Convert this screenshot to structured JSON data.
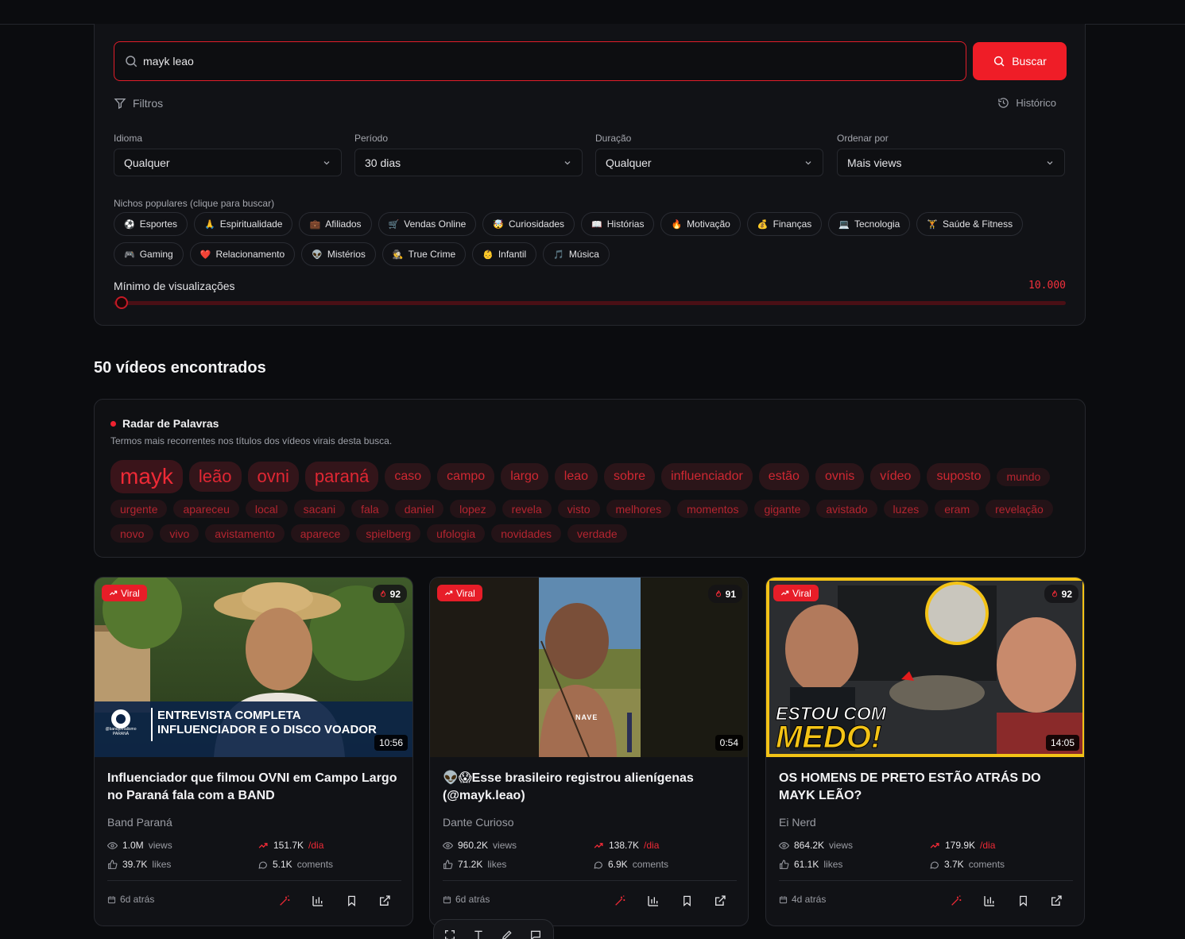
{
  "search": {
    "value": "mayk leao",
    "button_label": "Buscar"
  },
  "filters": {
    "toggle_label": "Filtros",
    "history_label": "Histórico",
    "idioma": {
      "label": "Idioma",
      "value": "Qualquer"
    },
    "periodo": {
      "label": "Período",
      "value": "30 dias"
    },
    "duracao": {
      "label": "Duração",
      "value": "Qualquer"
    },
    "ordenar": {
      "label": "Ordenar por",
      "value": "Mais views"
    }
  },
  "nichos": {
    "label": "Nichos populares (clique para buscar)",
    "items": [
      {
        "emoji": "⚽",
        "label": "Esportes"
      },
      {
        "emoji": "🙏",
        "label": "Espiritualidade"
      },
      {
        "emoji": "💼",
        "label": "Afiliados"
      },
      {
        "emoji": "🛒",
        "label": "Vendas Online"
      },
      {
        "emoji": "🤯",
        "label": "Curiosidades"
      },
      {
        "emoji": "📖",
        "label": "Histórias"
      },
      {
        "emoji": "🔥",
        "label": "Motivação"
      },
      {
        "emoji": "💰",
        "label": "Finanças"
      },
      {
        "emoji": "💻",
        "label": "Tecnologia"
      },
      {
        "emoji": "🏋",
        "label": "Saúde & Fitness"
      },
      {
        "emoji": "🎮",
        "label": "Gaming"
      },
      {
        "emoji": "❤️",
        "label": "Relacionamento"
      },
      {
        "emoji": "👽",
        "label": "Mistérios"
      },
      {
        "emoji": "🕵",
        "label": "True Crime"
      },
      {
        "emoji": "👶",
        "label": "Infantil"
      },
      {
        "emoji": "🎵",
        "label": "Música"
      }
    ]
  },
  "min_views": {
    "label": "Mínimo de visualizações",
    "value": "10.000",
    "fraction": 0.0
  },
  "results_title": "50 vídeos encontrados",
  "radar": {
    "title": "Radar de Palavras",
    "subtitle": "Termos mais recorrentes nos títulos dos vídeos virais desta busca.",
    "words": [
      {
        "w": "mayk",
        "t": 1
      },
      {
        "w": "leão",
        "t": 2
      },
      {
        "w": "ovni",
        "t": 2
      },
      {
        "w": "paraná",
        "t": 2
      },
      {
        "w": "caso",
        "t": 3
      },
      {
        "w": "campo",
        "t": 3
      },
      {
        "w": "largo",
        "t": 3
      },
      {
        "w": "leao",
        "t": 3
      },
      {
        "w": "sobre",
        "t": 3
      },
      {
        "w": "influenciador",
        "t": 3
      },
      {
        "w": "estão",
        "t": 3
      },
      {
        "w": "ovnis",
        "t": 3
      },
      {
        "w": "vídeo",
        "t": 3
      },
      {
        "w": "suposto",
        "t": 3
      },
      {
        "w": "mundo",
        "t": 4
      },
      {
        "w": "urgente",
        "t": 4
      },
      {
        "w": "apareceu",
        "t": 4
      },
      {
        "w": "local",
        "t": 4
      },
      {
        "w": "sacani",
        "t": 4
      },
      {
        "w": "fala",
        "t": 4
      },
      {
        "w": "daniel",
        "t": 4
      },
      {
        "w": "lopez",
        "t": 4
      },
      {
        "w": "revela",
        "t": 4
      },
      {
        "w": "visto",
        "t": 4
      },
      {
        "w": "melhores",
        "t": 4
      },
      {
        "w": "momentos",
        "t": 4
      },
      {
        "w": "gigante",
        "t": 4
      },
      {
        "w": "avistado",
        "t": 4
      },
      {
        "w": "luzes",
        "t": 4
      },
      {
        "w": "eram",
        "t": 4
      },
      {
        "w": "revelação",
        "t": 4
      },
      {
        "w": "novo",
        "t": 4
      },
      {
        "w": "vivo",
        "t": 4
      },
      {
        "w": "avistamento",
        "t": 4
      },
      {
        "w": "aparece",
        "t": 4
      },
      {
        "w": "spielberg",
        "t": 4
      },
      {
        "w": "ufologia",
        "t": 4
      },
      {
        "w": "novidades",
        "t": 4
      },
      {
        "w": "verdade",
        "t": 4
      }
    ]
  },
  "cards": [
    {
      "viral_label": "Viral",
      "score": "92",
      "duration": "10:56",
      "thumb_text": [
        "ENTREVISTA COMPLETA",
        "INFLUENCIADOR E O DISCO VOADOR"
      ],
      "thumb_logo_text": "@bandjornalismo PARANÁ",
      "title": "Influenciador que filmou OVNI em Campo Largo no Paraná fala com a BAND",
      "channel": "Band Paraná",
      "views": "1.0M",
      "views_unit": "views",
      "per_day": "151.7K",
      "per_day_unit": "/dia",
      "likes": "39.7K",
      "likes_unit": "likes",
      "comments": "5.1K",
      "comments_unit": "coments",
      "date": "6d atrás"
    },
    {
      "viral_label": "Viral",
      "score": "91",
      "duration": "0:54",
      "thumb_text": [
        "NAVE"
      ],
      "title": "👽😱Esse brasileiro registrou alienígenas (@mayk.leao)",
      "channel": "Dante Curioso",
      "views": "960.2K",
      "views_unit": "views",
      "per_day": "138.7K",
      "per_day_unit": "/dia",
      "likes": "71.2K",
      "likes_unit": "likes",
      "comments": "6.9K",
      "comments_unit": "coments",
      "date": "6d atrás"
    },
    {
      "viral_label": "Viral",
      "score": "92",
      "duration": "14:05",
      "thumb_text": [
        "ESTOU COM",
        "MEDO!"
      ],
      "title": "OS HOMENS DE PRETO ESTÃO ATRÁS DO MAYK LEÃO?",
      "channel": "Ei Nerd",
      "views": "864.2K",
      "views_unit": "views",
      "per_day": "179.9K",
      "per_day_unit": "/dia",
      "likes": "61.1K",
      "likes_unit": "likes",
      "comments": "3.7K",
      "comments_unit": "coments",
      "date": "4d atrás"
    }
  ],
  "colors": {
    "accent": "#ef1d27",
    "background": "#0b0c0f",
    "panel": "#111216"
  }
}
